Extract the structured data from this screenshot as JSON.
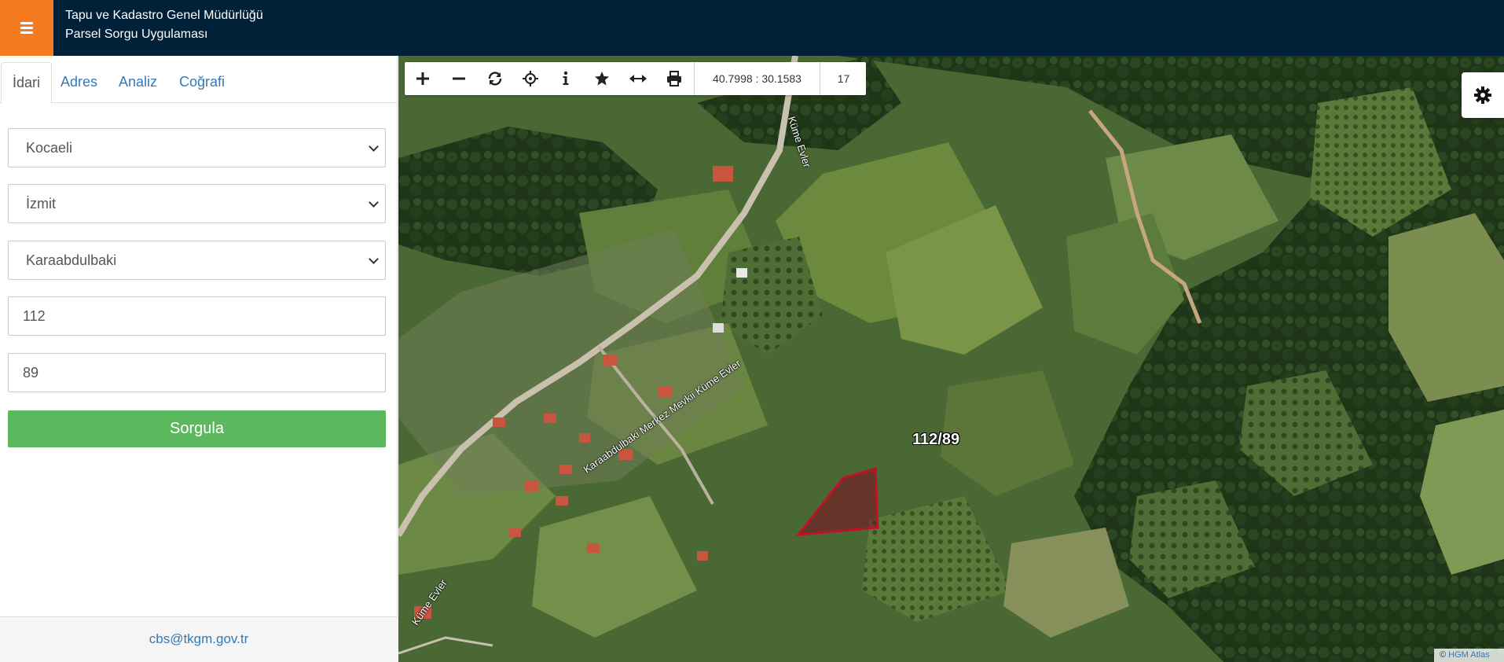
{
  "header": {
    "title_line1": "Tapu ve Kadastro Genel Müdürlüğü",
    "title_line2": "Parsel Sorgu Uygulaması"
  },
  "tabs": [
    {
      "label": "İdari",
      "active": true
    },
    {
      "label": "Adres",
      "active": false
    },
    {
      "label": "Analiz",
      "active": false
    },
    {
      "label": "Coğrafi",
      "active": false
    }
  ],
  "form": {
    "il": "Kocaeli",
    "ilce": "İzmit",
    "mahalle": "Karaabdulbaki",
    "ada": "112",
    "parsel": "89",
    "submit_label": "Sorgula"
  },
  "footer": {
    "email": "cbs@tkgm.gov.tr"
  },
  "toolbar": {
    "coordinates": "40.7998 : 30.1583",
    "zoom_level": "17",
    "icons": [
      "zoom-in-icon",
      "zoom-out-icon",
      "refresh-icon",
      "locate-icon",
      "info-icon",
      "star-icon",
      "measure-icon",
      "print-icon"
    ]
  },
  "map": {
    "parcel_label": "112/89",
    "road_label_1": "Karaabdulbaki Merkez Mevkii Küme Evler",
    "road_label_2": "Küme Evler",
    "road_label_3": "Küme Evler",
    "road_label_4": "Merkez Mevkii Küme Evler",
    "attribution_prefix": "©",
    "attribution_link": "HGM Atlas"
  },
  "colors": {
    "header_bg": "#012138",
    "menu_button": "#f47b20",
    "submit_button": "#5cb85c",
    "link": "#337ab7",
    "parcel_outline": "#c0102a"
  }
}
